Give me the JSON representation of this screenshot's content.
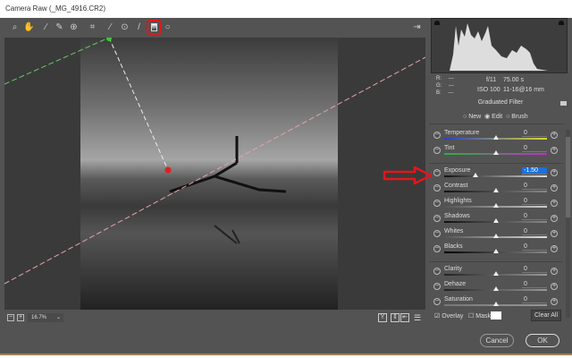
{
  "window": {
    "title": "Camera Raw (_MG_4916.CR2)"
  },
  "toolbar": {
    "tools": [
      "zoom-icon",
      "hand-icon",
      "white-balance-icon",
      "color-sampler-icon",
      "targeted-adjustment-icon",
      "crop-icon",
      "spot-removal-icon",
      "red-eye-icon",
      "adjustment-brush-icon",
      "graduated-filter-icon",
      "radial-filter-icon"
    ],
    "active_tool": "graduated-filter-icon",
    "highlight_color": "#e3161b"
  },
  "info": {
    "r": "R:",
    "g": "G:",
    "b": "B:",
    "rv": "---",
    "gv": "---",
    "bv": "---",
    "aperture": "f/11",
    "shutter": "75.00 s",
    "iso": "ISO 100",
    "lens": "11-16@16 mm"
  },
  "filter": {
    "title": "Graduated Filter",
    "modes": [
      "New",
      "Edit",
      "Brush"
    ],
    "selected_mode": "Edit"
  },
  "sliders": [
    {
      "label": "Temperature",
      "value": "0",
      "pos": 0.5,
      "track": "linear-gradient(90deg,#2a3fc8,#d8d830)"
    },
    {
      "label": "Tint",
      "value": "0",
      "pos": 0.5,
      "track": "linear-gradient(90deg,#2ab040,#c030c0)"
    },
    {
      "label": "Exposure",
      "value": "-1.50",
      "pos": 0.3,
      "track": "linear-gradient(90deg,#111,#ddd)",
      "highlight": true
    },
    {
      "label": "Contrast",
      "value": "0",
      "pos": 0.5,
      "track": "linear-gradient(90deg,#111,#888)"
    },
    {
      "label": "Highlights",
      "value": "0",
      "pos": 0.5,
      "track": "linear-gradient(90deg,#555,#ccc)"
    },
    {
      "label": "Shadows",
      "value": "0",
      "pos": 0.5,
      "track": "linear-gradient(90deg,#111,#888)"
    },
    {
      "label": "Whites",
      "value": "0",
      "pos": 0.5,
      "track": "linear-gradient(90deg,#555,#ddd)"
    },
    {
      "label": "Blacks",
      "value": "0",
      "pos": 0.5,
      "track": "linear-gradient(90deg,#000,#888)"
    },
    {
      "label": "Clarity",
      "value": "0",
      "pos": 0.5,
      "track": "linear-gradient(90deg,#222,#999)"
    },
    {
      "label": "Dehaze",
      "value": "0",
      "pos": 0.5,
      "track": "linear-gradient(90deg,#222,#999)"
    },
    {
      "label": "Saturation",
      "value": "0",
      "pos": 0.5,
      "track": "linear-gradient(90deg,#777,#999)"
    }
  ],
  "options": {
    "overlay": "Overlay",
    "overlay_checked": true,
    "mask": "Mask",
    "mask_checked": false,
    "clear_all": "Clear All"
  },
  "zoom": {
    "level": "16.7%"
  },
  "buttons": {
    "cancel": "Cancel",
    "ok": "OK"
  }
}
